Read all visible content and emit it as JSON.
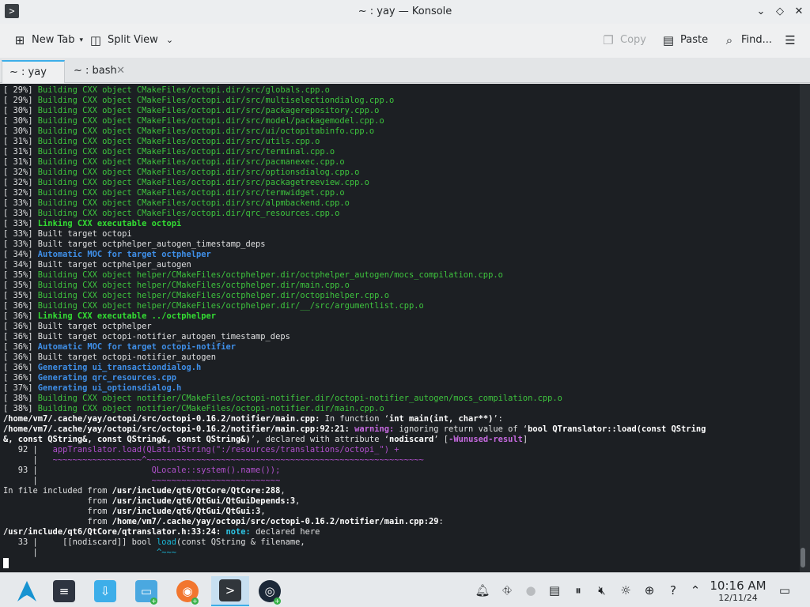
{
  "window": {
    "title": "~ : yay — Konsole"
  },
  "toolbar": {
    "new_tab": "New Tab",
    "split_view": "Split View",
    "copy": "Copy",
    "paste": "Paste",
    "find": "Find..."
  },
  "tabs": [
    {
      "label": "~ : yay",
      "active": true
    },
    {
      "label": "~ : bash",
      "active": false
    }
  ],
  "terminal_lines": [
    [
      [
        "w",
        "[ 29%] "
      ],
      [
        "g",
        "Building CXX object CMakeFiles/octopi.dir/src/globals.cpp.o"
      ]
    ],
    [
      [
        "w",
        "[ 29%] "
      ],
      [
        "g",
        "Building CXX object CMakeFiles/octopi.dir/src/multiselectiondialog.cpp.o"
      ]
    ],
    [
      [
        "w",
        "[ 30%] "
      ],
      [
        "g",
        "Building CXX object CMakeFiles/octopi.dir/src/packagerepository.cpp.o"
      ]
    ],
    [
      [
        "w",
        "[ 30%] "
      ],
      [
        "g",
        "Building CXX object CMakeFiles/octopi.dir/src/model/packagemodel.cpp.o"
      ]
    ],
    [
      [
        "w",
        "[ 30%] "
      ],
      [
        "g",
        "Building CXX object CMakeFiles/octopi.dir/src/ui/octopitabinfo.cpp.o"
      ]
    ],
    [
      [
        "w",
        "[ 31%] "
      ],
      [
        "g",
        "Building CXX object CMakeFiles/octopi.dir/src/utils.cpp.o"
      ]
    ],
    [
      [
        "w",
        "[ 31%] "
      ],
      [
        "g",
        "Building CXX object CMakeFiles/octopi.dir/src/terminal.cpp.o"
      ]
    ],
    [
      [
        "w",
        "[ 31%] "
      ],
      [
        "g",
        "Building CXX object CMakeFiles/octopi.dir/src/pacmanexec.cpp.o"
      ]
    ],
    [
      [
        "w",
        "[ 32%] "
      ],
      [
        "g",
        "Building CXX object CMakeFiles/octopi.dir/src/optionsdialog.cpp.o"
      ]
    ],
    [
      [
        "w",
        "[ 32%] "
      ],
      [
        "g",
        "Building CXX object CMakeFiles/octopi.dir/src/packagetreeview.cpp.o"
      ]
    ],
    [
      [
        "w",
        "[ 32%] "
      ],
      [
        "g",
        "Building CXX object CMakeFiles/octopi.dir/src/termwidget.cpp.o"
      ]
    ],
    [
      [
        "w",
        "[ 33%] "
      ],
      [
        "g",
        "Building CXX object CMakeFiles/octopi.dir/src/alpmbackend.cpp.o"
      ]
    ],
    [
      [
        "w",
        "[ 33%] "
      ],
      [
        "g",
        "Building CXX object CMakeFiles/octopi.dir/qrc_resources.cpp.o"
      ]
    ],
    [
      [
        "w",
        "[ 33%] "
      ],
      [
        "bg",
        "Linking CXX executable octopi"
      ]
    ],
    [
      [
        "w",
        "[ 33%] Built target octopi"
      ]
    ],
    [
      [
        "w",
        "[ 33%] Built target octphelper_autogen_timestamp_deps"
      ]
    ],
    [
      [
        "w",
        "[ 34%] "
      ],
      [
        "bb",
        "Automatic MOC for target octphelper"
      ]
    ],
    [
      [
        "w",
        "[ 34%] Built target octphelper_autogen"
      ]
    ],
    [
      [
        "w",
        "[ 35%] "
      ],
      [
        "g",
        "Building CXX object helper/CMakeFiles/octphelper.dir/octphelper_autogen/mocs_compilation.cpp.o"
      ]
    ],
    [
      [
        "w",
        "[ 35%] "
      ],
      [
        "g",
        "Building CXX object helper/CMakeFiles/octphelper.dir/main.cpp.o"
      ]
    ],
    [
      [
        "w",
        "[ 35%] "
      ],
      [
        "g",
        "Building CXX object helper/CMakeFiles/octphelper.dir/octopihelper.cpp.o"
      ]
    ],
    [
      [
        "w",
        "[ 36%] "
      ],
      [
        "g",
        "Building CXX object helper/CMakeFiles/octphelper.dir/__/src/argumentlist.cpp.o"
      ]
    ],
    [
      [
        "w",
        "[ 36%] "
      ],
      [
        "bg",
        "Linking CXX executable ../octphelper"
      ]
    ],
    [
      [
        "w",
        "[ 36%] Built target octphelper"
      ]
    ],
    [
      [
        "w",
        "[ 36%] Built target octopi-notifier_autogen_timestamp_deps"
      ]
    ],
    [
      [
        "w",
        "[ 36%] "
      ],
      [
        "bb",
        "Automatic MOC for target octopi-notifier"
      ]
    ],
    [
      [
        "w",
        "[ 36%] Built target octopi-notifier_autogen"
      ]
    ],
    [
      [
        "w",
        "[ 36%] "
      ],
      [
        "bb",
        "Generating ui_transactiondialog.h"
      ]
    ],
    [
      [
        "w",
        "[ 36%] "
      ],
      [
        "bb",
        "Generating qrc_resources.cpp"
      ]
    ],
    [
      [
        "w",
        "[ 37%] "
      ],
      [
        "bb",
        "Generating ui_optionsdialog.h"
      ]
    ],
    [
      [
        "w",
        "[ 38%] "
      ],
      [
        "g",
        "Building CXX object notifier/CMakeFiles/octopi-notifier.dir/octopi-notifier_autogen/mocs_compilation.cpp.o"
      ]
    ],
    [
      [
        "w",
        "[ 38%] "
      ],
      [
        "g",
        "Building CXX object notifier/CMakeFiles/octopi-notifier.dir/main.cpp.o"
      ]
    ],
    [
      [
        "wb",
        "/home/vm7/.cache/yay/octopi/src/octopi-0.16.2/notifier/main.cpp:"
      ],
      [
        "w",
        " In function ‘"
      ],
      [
        "wb",
        "int main(int, char**)"
      ],
      [
        "w",
        "’:"
      ]
    ],
    [
      [
        "wb",
        "/home/vm7/.cache/yay/octopi/src/octopi-0.16.2/notifier/main.cpp:92:21:"
      ],
      [
        "w",
        " "
      ],
      [
        "mb",
        "warning:"
      ],
      [
        "w",
        " ignoring return value of ‘"
      ],
      [
        "wb",
        "bool QTranslator::load(const QString"
      ]
    ],
    [
      [
        "wb",
        "&, const QString&, const QString&, const QString&)"
      ],
      [
        "w",
        "’, declared with attribute ‘"
      ],
      [
        "wb",
        "nodiscard"
      ],
      [
        "w",
        "’ ["
      ],
      [
        "mb",
        "-Wunused-result"
      ],
      [
        "w",
        "]"
      ]
    ],
    [
      [
        "w",
        "   92 |   "
      ],
      [
        "m",
        "appTranslator.load(QLatin1String(\":/resources/translations/octopi_\") +"
      ]
    ],
    [
      [
        "w",
        "      |   "
      ],
      [
        "m",
        "~~~~~~~~~~~~~~~~~~^~~~~~~~~~~~~~~~~~~~~~~~~~~~~~~~~~~~~~~~~~~~~~~~~~~~~~~~~"
      ]
    ],
    [
      [
        "w",
        "   93 |                       "
      ],
      [
        "m",
        "QLocale::system().name());"
      ]
    ],
    [
      [
        "w",
        "      |                       "
      ],
      [
        "m",
        "~~~~~~~~~~~~~~~~~~~~~~~~~~"
      ]
    ],
    [
      [
        "w",
        "In file included from "
      ],
      [
        "wb",
        "/usr/include/qt6/QtCore/QtCore:288"
      ],
      [
        "w",
        ","
      ]
    ],
    [
      [
        "w",
        "                 from "
      ],
      [
        "wb",
        "/usr/include/qt6/QtGui/QtGuiDepends:3"
      ],
      [
        "w",
        ","
      ]
    ],
    [
      [
        "w",
        "                 from "
      ],
      [
        "wb",
        "/usr/include/qt6/QtGui/QtGui:3"
      ],
      [
        "w",
        ","
      ]
    ],
    [
      [
        "w",
        "                 from "
      ],
      [
        "wb",
        "/home/vm7/.cache/yay/octopi/src/octopi-0.16.2/notifier/main.cpp:29"
      ],
      [
        "w",
        ":"
      ]
    ],
    [
      [
        "wb",
        "/usr/include/qt6/QtCore/qtranslator.h:33:24:"
      ],
      [
        "w",
        " "
      ],
      [
        "cb",
        "note:"
      ],
      [
        "w",
        " declared here"
      ]
    ],
    [
      [
        "w",
        "   33 |     [[nodiscard]] bool "
      ],
      [
        "c",
        "load"
      ],
      [
        "w",
        "(const QString & filename,"
      ]
    ],
    [
      [
        "w",
        "      |                        "
      ],
      [
        "c",
        "^~~~"
      ]
    ]
  ],
  "taskbar": {
    "clock_time": "10:16 AM",
    "clock_date": "12/11/24"
  },
  "colors": {
    "terminal_bg": "#1c1f23",
    "accent": "#3daee9",
    "build_green": "#3ec43e",
    "moc_blue": "#3f8fe8",
    "warning_magenta": "#c66ae0",
    "note_cyan": "#2ec6e6"
  },
  "icons": {
    "app": "konsole-icon",
    "new_tab": "new-tab-icon",
    "split_view": "split-view-icon",
    "copy": "copy-icon",
    "paste": "paste-icon",
    "find": "search-icon",
    "menu": "hamburger-menu-icon"
  }
}
